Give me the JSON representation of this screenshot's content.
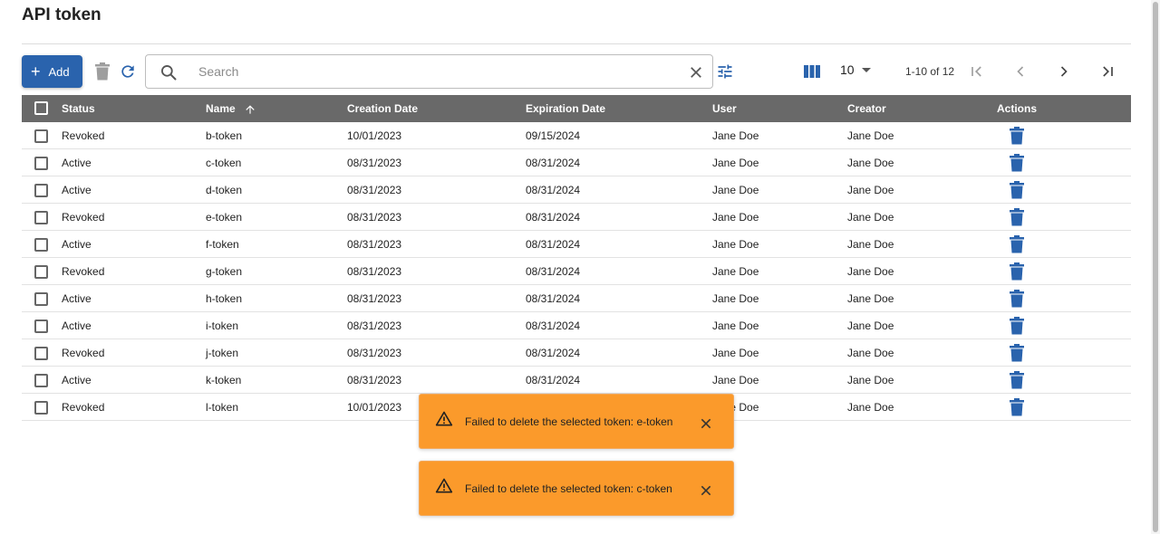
{
  "page": {
    "title": "API token"
  },
  "toolbar": {
    "add_label": "Add",
    "search_placeholder": "Search",
    "search_value": "",
    "page_size": "10",
    "range": "1-10 of 12"
  },
  "colors": {
    "accent": "#2a63ad",
    "header_bg": "#696969",
    "toast_bg": "#fb9a2b"
  },
  "table": {
    "headers": {
      "status": "Status",
      "name": "Name",
      "created": "Creation Date",
      "expire": "Expiration Date",
      "user": "User",
      "creator": "Creator",
      "actions": "Actions"
    },
    "rows": [
      {
        "status": "Revoked",
        "name": "b-token",
        "created": "10/01/2023",
        "expire": "09/15/2024",
        "user": "Jane Doe",
        "creator": "Jane Doe"
      },
      {
        "status": "Active",
        "name": "c-token",
        "created": "08/31/2023",
        "expire": "08/31/2024",
        "user": "Jane Doe",
        "creator": "Jane Doe"
      },
      {
        "status": "Active",
        "name": "d-token",
        "created": "08/31/2023",
        "expire": "08/31/2024",
        "user": "Jane Doe",
        "creator": "Jane Doe"
      },
      {
        "status": "Revoked",
        "name": "e-token",
        "created": "08/31/2023",
        "expire": "08/31/2024",
        "user": "Jane Doe",
        "creator": "Jane Doe"
      },
      {
        "status": "Active",
        "name": "f-token",
        "created": "08/31/2023",
        "expire": "08/31/2024",
        "user": "Jane Doe",
        "creator": "Jane Doe"
      },
      {
        "status": "Revoked",
        "name": "g-token",
        "created": "08/31/2023",
        "expire": "08/31/2024",
        "user": "Jane Doe",
        "creator": "Jane Doe"
      },
      {
        "status": "Active",
        "name": "h-token",
        "created": "08/31/2023",
        "expire": "08/31/2024",
        "user": "Jane Doe",
        "creator": "Jane Doe"
      },
      {
        "status": "Active",
        "name": "i-token",
        "created": "08/31/2023",
        "expire": "08/31/2024",
        "user": "Jane Doe",
        "creator": "Jane Doe"
      },
      {
        "status": "Revoked",
        "name": "j-token",
        "created": "08/31/2023",
        "expire": "08/31/2024",
        "user": "Jane Doe",
        "creator": "Jane Doe"
      },
      {
        "status": "Active",
        "name": "k-token",
        "created": "08/31/2023",
        "expire": "08/31/2024",
        "user": "Jane Doe",
        "creator": "Jane Doe"
      },
      {
        "status": "Revoked",
        "name": "l-token",
        "created": "10/01/2023",
        "expire": "",
        "user": "Jane Doe",
        "creator": "Jane Doe"
      }
    ]
  },
  "toasts": [
    {
      "message": "Failed to delete the selected token: e-token"
    },
    {
      "message": "Failed to delete the selected token: c-token"
    }
  ],
  "icons": {
    "add": "plus-icon",
    "delete": "trash-icon",
    "refresh": "refresh-icon",
    "search": "search-icon",
    "clear": "close-icon",
    "filter": "tune-icon",
    "columns": "view-column-icon",
    "first": "first-page-icon",
    "prev": "chevron-left-icon",
    "next": "chevron-right-icon",
    "last": "last-page-icon",
    "warning": "warning-icon"
  }
}
